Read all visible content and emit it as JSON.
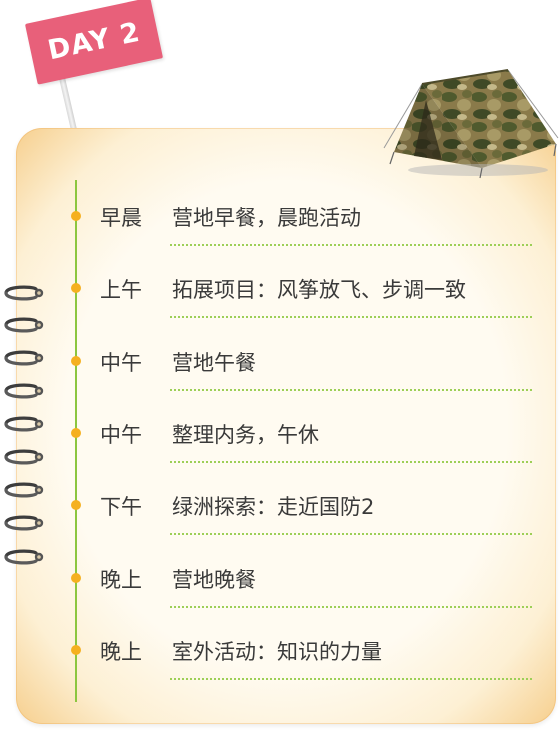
{
  "badge": {
    "day_label": "DAY 2"
  },
  "schedule": [
    {
      "time": "早晨",
      "activity": "营地早餐，晨跑活动"
    },
    {
      "time": "上午",
      "activity": "拓展项目：风筝放飞、步调一致"
    },
    {
      "time": "中午",
      "activity": "营地午餐"
    },
    {
      "time": "中午",
      "activity": "整理内务，午休"
    },
    {
      "time": "下午",
      "activity": "绿洲探索：走近国防2"
    },
    {
      "time": "晚上",
      "activity": "营地晚餐"
    },
    {
      "time": "晚上",
      "activity": "室外活动：知识的力量"
    }
  ],
  "colors": {
    "flag": "#e8607a",
    "timeline": "#8cc63f",
    "dot": "#f5b020",
    "divider": "#9dcf57",
    "paper": "#fffbf1",
    "paper_edge": "#f6cf8e"
  },
  "icons": {
    "flag": "pennant-flag-icon",
    "binding": "spiral-binding-icon",
    "tent": "camouflage-tent-icon"
  }
}
